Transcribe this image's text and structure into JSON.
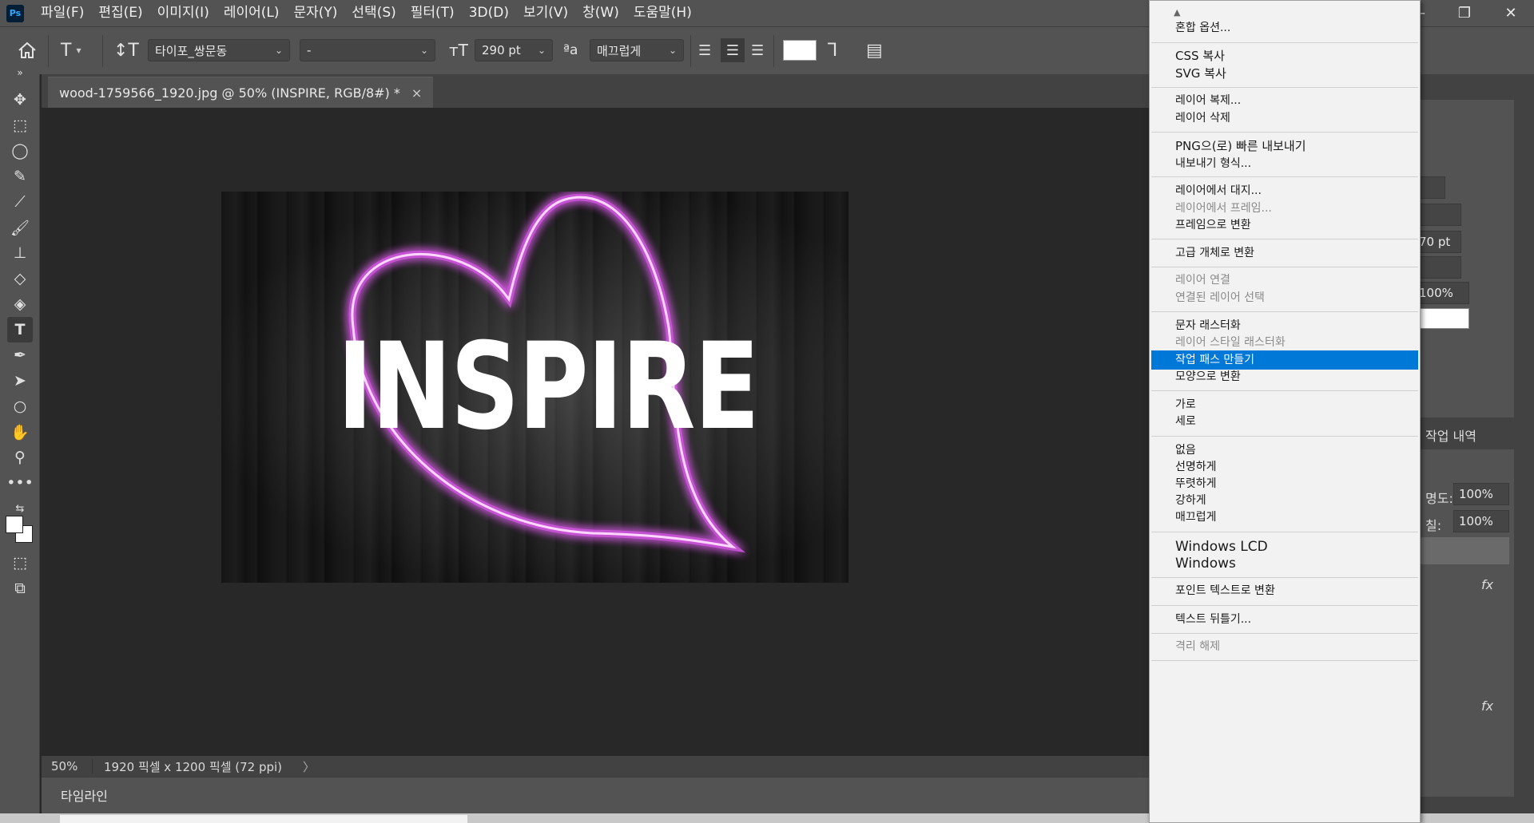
{
  "menubar": {
    "items": [
      "파일(F)",
      "편집(E)",
      "이미지(I)",
      "레이어(L)",
      "문자(Y)",
      "선택(S)",
      "필터(T)",
      "3D(D)",
      "보기(V)",
      "창(W)",
      "도움말(H)"
    ],
    "logo": "Ps"
  },
  "options": {
    "font_family": "타이포_쌍문동",
    "font_style": "-",
    "font_size": "290 pt",
    "anti_alias": "매끄럽게",
    "text_color": "#ffffff"
  },
  "document": {
    "tab_title": "wood-1759566_1920.jpg @ 50% (INSPIRE, RGB/8#) *",
    "close": "×",
    "artwork_text": "INSPIRE",
    "neon_color": "#e05cf0"
  },
  "status": {
    "zoom": "50%",
    "dimensions": "1920 픽셀 x 1200 픽셀 (72 ppi)",
    "arrow": "〉"
  },
  "timeline": {
    "label": "타임라인"
  },
  "right_panel": {
    "size_partial": "70 pt",
    "scale_partial": "100%",
    "opacity_label": "명도:",
    "opacity_value": "100%",
    "fill_label": "칠:",
    "fill_value": "100%",
    "history_tab": "작업 내역",
    "fx": "fx"
  },
  "context_menu": {
    "items": [
      {
        "label": "혼합 옵션...",
        "state": "normal"
      },
      {
        "label": "CSS 복사",
        "state": "normal"
      },
      {
        "label": "SVG 복사",
        "state": "normal"
      },
      {
        "label": "레이어 복제...",
        "state": "normal"
      },
      {
        "label": "레이어 삭제",
        "state": "normal"
      },
      {
        "label": "PNG으(로) 빠른 내보내기",
        "state": "normal"
      },
      {
        "label": "내보내기 형식...",
        "state": "normal"
      },
      {
        "label": "레이어에서 대지...",
        "state": "normal"
      },
      {
        "label": "레이어에서 프레임...",
        "state": "disabled"
      },
      {
        "label": "프레임으로 변환",
        "state": "normal"
      },
      {
        "label": "고급 개체로 변환",
        "state": "normal"
      },
      {
        "label": "레이어 연결",
        "state": "disabled"
      },
      {
        "label": "연결된 레이어 선택",
        "state": "disabled"
      },
      {
        "label": "문자 래스터화",
        "state": "normal"
      },
      {
        "label": "레이어 스타일 래스터화",
        "state": "disabled"
      },
      {
        "label": "작업 패스 만들기",
        "state": "selected"
      },
      {
        "label": "모양으로 변환",
        "state": "normal"
      },
      {
        "label": "가로",
        "state": "normal"
      },
      {
        "label": "세로",
        "state": "normal"
      },
      {
        "label": "없음",
        "state": "normal"
      },
      {
        "label": "선명하게",
        "state": "normal"
      },
      {
        "label": "뚜렷하게",
        "state": "normal"
      },
      {
        "label": "강하게",
        "state": "normal"
      },
      {
        "label": "매끄럽게",
        "state": "normal"
      },
      {
        "label": "Windows LCD",
        "state": "normal"
      },
      {
        "label": "Windows",
        "state": "normal"
      },
      {
        "label": "포인트 텍스트로 변환",
        "state": "normal"
      },
      {
        "label": "텍스트 뒤틀기...",
        "state": "normal"
      },
      {
        "label": "격리 해제",
        "state": "disabled"
      }
    ]
  }
}
